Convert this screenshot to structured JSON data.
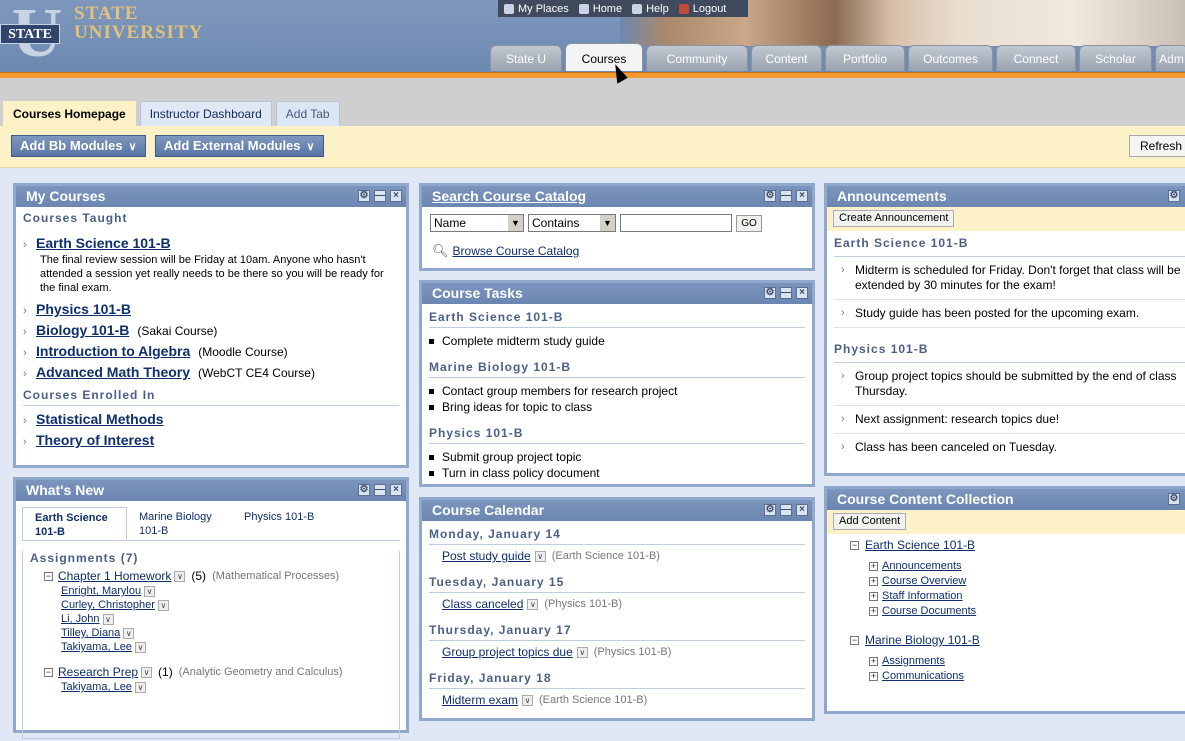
{
  "logo": {
    "line1": "STATE",
    "line2": "UNIVERSITY",
    "badge": "STATE"
  },
  "util_links": [
    "My Places",
    "Home",
    "Help",
    "Logout"
  ],
  "main_tabs": [
    "State U",
    "Courses",
    "Community",
    "Content",
    "Portfolio",
    "Outcomes",
    "Connect",
    "Scholar",
    "Adm"
  ],
  "active_tab": "Courses",
  "sub_tabs": {
    "active": "Courses Homepage",
    "other": "Instructor Dashboard",
    "add": "Add Tab"
  },
  "module_buttons": {
    "bb": "Add Bb Modules",
    "external": "Add External Modules",
    "refresh": "Refresh"
  },
  "my_courses": {
    "title": "My Courses",
    "taught_label": "Courses Taught",
    "taught": [
      {
        "name": "Earth Science 101-B",
        "note": "",
        "desc": "The final review session will be Friday at 10am. Anyone who hasn't attended a session yet really needs to be there so you will be ready for the final exam."
      },
      {
        "name": "Physics 101-B",
        "note": ""
      },
      {
        "name": "Biology 101-B",
        "note": "(Sakai Course)"
      },
      {
        "name": "Introduction to Algebra",
        "note": "(Moodle Course)"
      },
      {
        "name": "Advanced Math Theory",
        "note": "(WebCT CE4 Course)"
      }
    ],
    "enrolled_label": "Courses Enrolled In",
    "enrolled": [
      "Statistical Methods",
      "Theory of Interest"
    ]
  },
  "whats_new": {
    "title": "What's New",
    "tabs": [
      "Earth Science 101-B",
      "Marine Biology 101-B",
      "Physics 101-B"
    ],
    "section": "Assignments",
    "section_count": "(7)",
    "groups": [
      {
        "name": "Chapter 1 Homework",
        "count": "(5)",
        "category": "(Mathematical Processes)",
        "students": [
          "Enright, Marylou",
          "Curley, Christopher",
          "Li, John",
          "Tilley, Diana",
          "Takiyama, Lee"
        ]
      },
      {
        "name": "Research Prep",
        "count": "(1)",
        "category": "(Analytic Geometry and Calculus)",
        "students": [
          "Takiyama, Lee"
        ]
      }
    ]
  },
  "search_catalog": {
    "title": "Search Course Catalog",
    "field": "Name",
    "operator": "Contains",
    "go": "GO",
    "browse": "Browse Course Catalog"
  },
  "course_tasks": {
    "title": "Course Tasks",
    "groups": [
      {
        "course": "Earth Science 101-B",
        "tasks": [
          "Complete midterm study guide"
        ]
      },
      {
        "course": "Marine Biology 101-B",
        "tasks": [
          "Contact group members for research project",
          "Bring ideas for topic to class"
        ]
      },
      {
        "course": "Physics 101-B",
        "tasks": [
          "Submit group project topic",
          "Turn in class policy document"
        ]
      }
    ]
  },
  "course_calendar": {
    "title": "Course Calendar",
    "days": [
      {
        "date": "Monday, January 14",
        "event": "Post study guide",
        "course": "(Earth Science 101-B)"
      },
      {
        "date": "Tuesday, January 15",
        "event": "Class canceled",
        "course": "(Physics 101-B)"
      },
      {
        "date": "Thursday, January 17",
        "event": "Group project topics due",
        "course": "(Physics 101-B)"
      },
      {
        "date": "Friday, January 18",
        "event": "Midterm exam",
        "course": "(Earth Science 101-B)"
      }
    ]
  },
  "announcements": {
    "title": "Announcements",
    "button": "Create Announcement",
    "groups": [
      {
        "course": "Earth Science 101-B",
        "items": [
          "Midterm is scheduled for Friday. Don't forget that class will be extended by 30 minutes for the exam!",
          "Study guide has been posted for the upcoming exam."
        ]
      },
      {
        "course": "Physics 101-B",
        "items": [
          "Group project topics should be submitted by the end of class Thursday.",
          "Next assignment: research topics due!",
          "Class has been canceled on Tuesday."
        ]
      }
    ]
  },
  "content_collection": {
    "title": "Course Content Collection",
    "button": "Add Content",
    "courses": [
      {
        "name": "Earth Science 101-B",
        "folders": [
          "Announcements",
          "Course Overview",
          "Staff Information",
          "Course Documents"
        ]
      },
      {
        "name": "Marine Biology 101-B",
        "folders": [
          "Assignments",
          "Communications"
        ]
      }
    ]
  }
}
